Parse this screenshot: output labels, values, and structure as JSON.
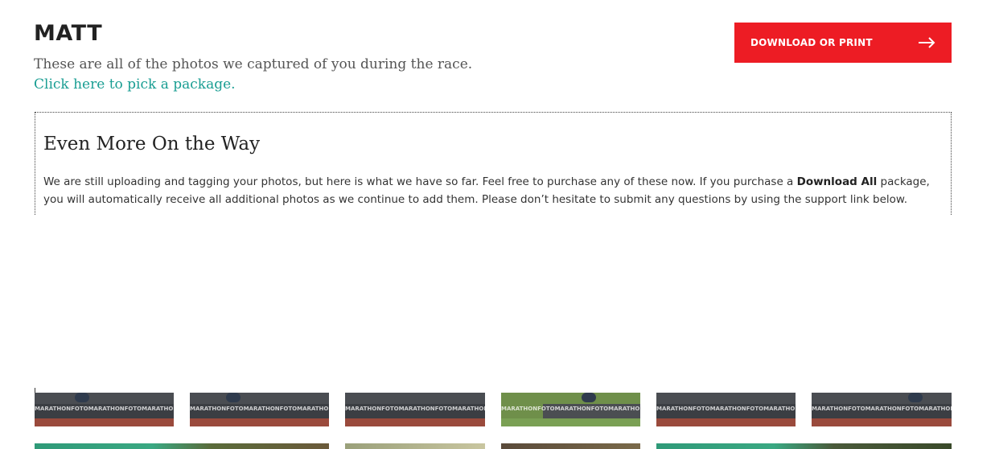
{
  "header": {
    "runner_name": "MATT",
    "subtitle": "These are all of the photos we captured of you during the race.",
    "pick_link": "Click here to pick a package.",
    "download_button_label": "DOWNLOAD OR PRINT"
  },
  "notice": {
    "title": "Even More On the Way",
    "body_part1": "We are still uploading and tagging your photos, but here is what we have so far. Feel free to purchase any of these now. If you purchase a ",
    "body_bold": "Download All",
    "body_part2": " package, you will automatically receive all additional photos as we continue to add them. Please don’t hesitate to submit any questions by using the support link below."
  },
  "photos": {
    "watermark": "MARATHONFOTO"
  },
  "colors": {
    "accent_red": "#ed1c24",
    "link_teal": "#1a9e93"
  }
}
